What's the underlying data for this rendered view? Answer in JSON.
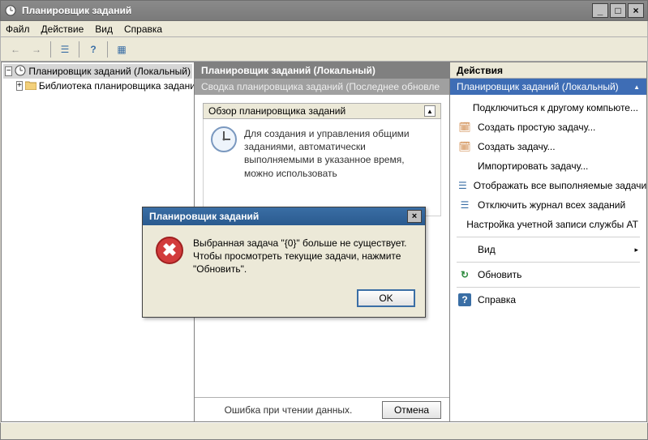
{
  "window": {
    "title": "Планировщик заданий",
    "minimize": "_",
    "maximize": "□",
    "close": "×"
  },
  "menu": {
    "file": "Файл",
    "action": "Действие",
    "view": "Вид",
    "help": "Справка"
  },
  "toolbar": {
    "back": "←",
    "forward": "→",
    "up": "☰",
    "help": "?",
    "view": "▦"
  },
  "tree": {
    "root": "Планировщик заданий (Локальный)",
    "library": "Библиотека планировщика заданий"
  },
  "center": {
    "header": "Планировщик заданий (Локальный)",
    "sub": "Сводка планировщика заданий (Последнее обновле",
    "overviewTitle": "Обзор планировщика заданий",
    "overviewText": "Для создания и управления общими заданиями, автоматически выполняемыми в указанное время, можно использовать",
    "footerError": "Ошибка при чтении данных.",
    "cancel": "Отмена"
  },
  "actions": {
    "header": "Действия",
    "panelTitle": "Планировщик заданий (Локальный)",
    "collapse": "▲",
    "items": [
      {
        "icon": "",
        "label": "Подключиться к другому компьюте..."
      },
      {
        "icon": "🗓",
        "label": "Создать простую задачу..."
      },
      {
        "icon": "🗓",
        "label": "Создать задачу..."
      },
      {
        "icon": "",
        "label": "Импортировать задачу..."
      },
      {
        "icon": "☰",
        "label": "Отображать все выполняемые задачи"
      },
      {
        "icon": "☰",
        "label": "Отключить журнал всех заданий"
      },
      {
        "icon": "",
        "label": "Настройка учетной записи службы AT"
      }
    ],
    "view": "Вид",
    "viewArrow": "▸",
    "refresh": {
      "icon": "↻",
      "label": "Обновить"
    },
    "help": {
      "icon": "?",
      "label": "Справка"
    }
  },
  "dialog": {
    "title": "Планировщик заданий",
    "text": "Выбранная задача \"{0}\" больше не существует. Чтобы просмотреть текущие задачи, нажмите \"Обновить\".",
    "ok": "OK",
    "close": "×"
  },
  "colors": {
    "accent": "#3e6db5"
  }
}
